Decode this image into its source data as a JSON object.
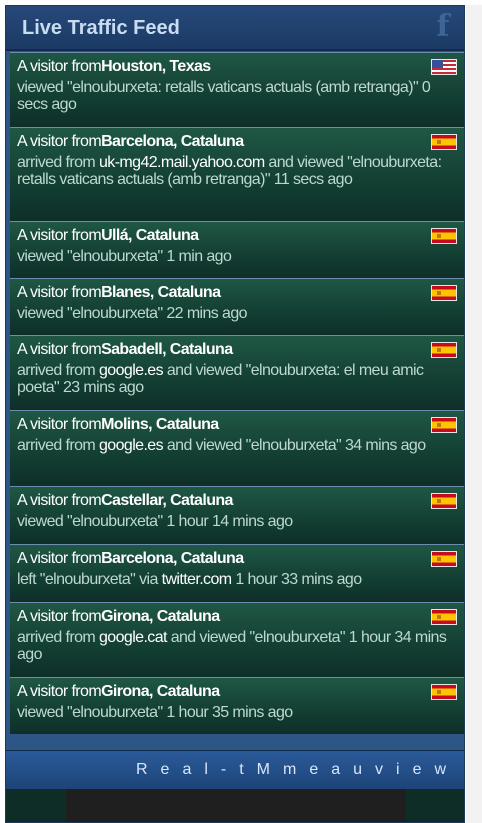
{
  "header": {
    "title": "Live Traffic Feed",
    "logo_letter": "f"
  },
  "items": [
    {
      "prefix": "A visitor from",
      "place": "Houston, Texas",
      "detail_pre": "viewed \"elnouburxeta: retalls vaticans actuals (amb retranga)\" 0 secs ago",
      "detail_source": "",
      "detail_post": "",
      "flag": "us"
    },
    {
      "prefix": "A visitor from",
      "place": "Barcelona, Cataluna",
      "detail_pre": "arrived from ",
      "detail_source": "uk-mg42.mail.yahoo.com",
      "detail_post": " and viewed \"elnouburxeta: retalls vaticans actuals (amb retranga)\" 11 secs ago",
      "flag": "es"
    },
    {
      "prefix": "A visitor from",
      "place": "Ullá, Cataluna",
      "detail_pre": "viewed \"elnouburxeta\" 1 min ago",
      "detail_source": "",
      "detail_post": "",
      "flag": "es"
    },
    {
      "prefix": "A visitor from",
      "place": "Blanes, Cataluna",
      "detail_pre": "viewed \"elnouburxeta\" 22 mins ago",
      "detail_source": "",
      "detail_post": "",
      "flag": "es"
    },
    {
      "prefix": "A visitor from",
      "place": "Sabadell, Cataluna",
      "detail_pre": "arrived from ",
      "detail_source": "google.es",
      "detail_post": " and viewed \"elnouburxeta: el meu amic poeta\" 23 mins ago",
      "flag": "es"
    },
    {
      "prefix": "A visitor from",
      "place": "Molins, Cataluna",
      "detail_pre": "arrived from ",
      "detail_source": "google.es",
      "detail_post": " and viewed \"elnouburxeta\" 34 mins ago",
      "flag": "es"
    },
    {
      "prefix": "A visitor from",
      "place": "Castellar, Cataluna",
      "detail_pre": "viewed \"elnouburxeta\" 1 hour 14 mins ago",
      "detail_source": "",
      "detail_post": "",
      "flag": "es"
    },
    {
      "prefix": "A visitor from",
      "place": "Barcelona, Cataluna",
      "detail_pre": "left \"elnouburxeta\" via ",
      "detail_source": "twitter.com",
      "detail_post": " 1 hour 33 mins ago",
      "flag": "es"
    },
    {
      "prefix": "A visitor from",
      "place": "Girona, Cataluna",
      "detail_pre": "arrived from ",
      "detail_source": "google.cat",
      "detail_post": " and viewed \"elnouburxeta\" 1 hour 34 mins ago",
      "flag": "es"
    },
    {
      "prefix": "A visitor from",
      "place": "Girona, Cataluna",
      "detail_pre": "viewed \"elnouburxeta\" 1 hour 35 mins ago",
      "detail_source": "",
      "detail_post": "",
      "flag": "es"
    }
  ],
  "footer": {
    "text": "Real-tMmeauview"
  },
  "colors": {
    "header_bg": "#1b3a64",
    "item_bg": "#113a30",
    "title_text": "#c9dcf2"
  }
}
